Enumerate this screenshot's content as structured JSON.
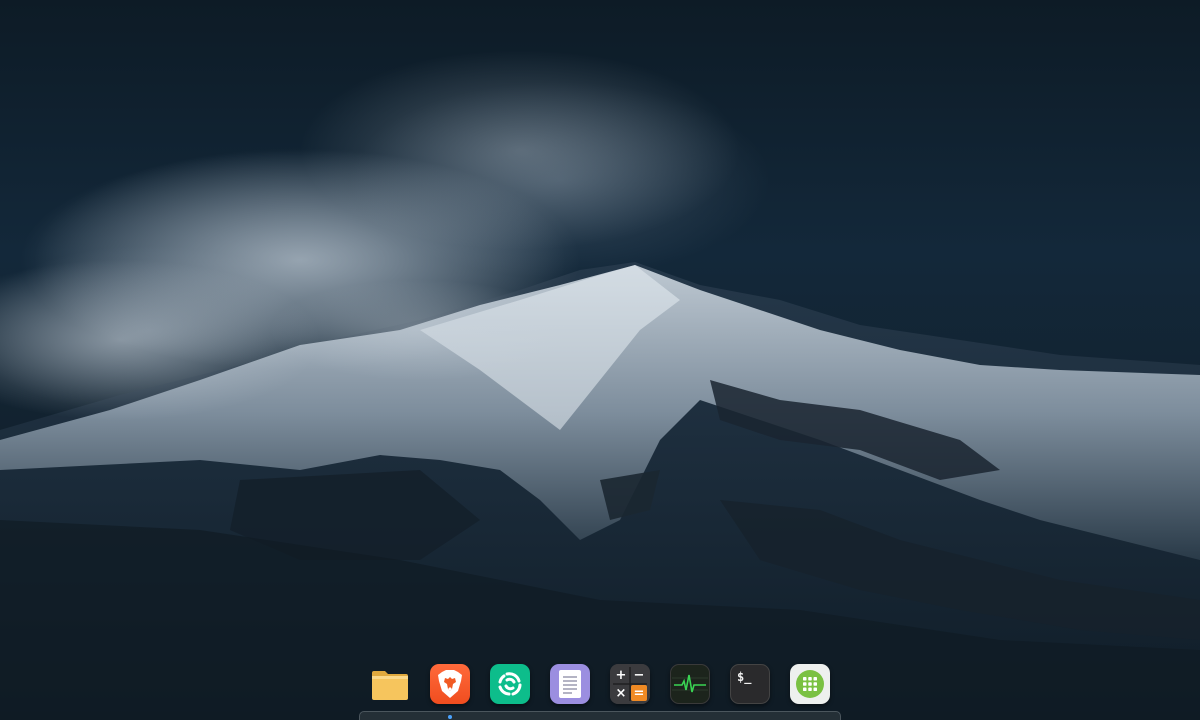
{
  "desktop": {
    "wallpaper": "snow-covered-mountain-night"
  },
  "dock": {
    "items": [
      {
        "name": "files",
        "icon": "folder-icon",
        "color": "#f6c55d"
      },
      {
        "name": "brave-browser",
        "icon": "brave-lion-icon",
        "color": "#f4511e"
      },
      {
        "name": "element",
        "icon": "element-icon",
        "color": "#0dbd8b"
      },
      {
        "name": "text-editor",
        "icon": "document-icon",
        "color": "#9b8ee0"
      },
      {
        "name": "calculator",
        "icon": "calculator-icon",
        "color": "#3b3b3e"
      },
      {
        "name": "system-monitor",
        "icon": "activity-icon",
        "color": "#1c241c"
      },
      {
        "name": "terminal",
        "icon": "terminal-icon",
        "color": "#2a2a2c"
      },
      {
        "name": "app-launcher",
        "icon": "app-grid-icon",
        "color": "#7ac142"
      }
    ],
    "terminal_prompt": "$_",
    "calculator_symbols": [
      "+",
      "−",
      "×",
      "="
    ],
    "running_indicator_color": "#4aa3ff"
  }
}
